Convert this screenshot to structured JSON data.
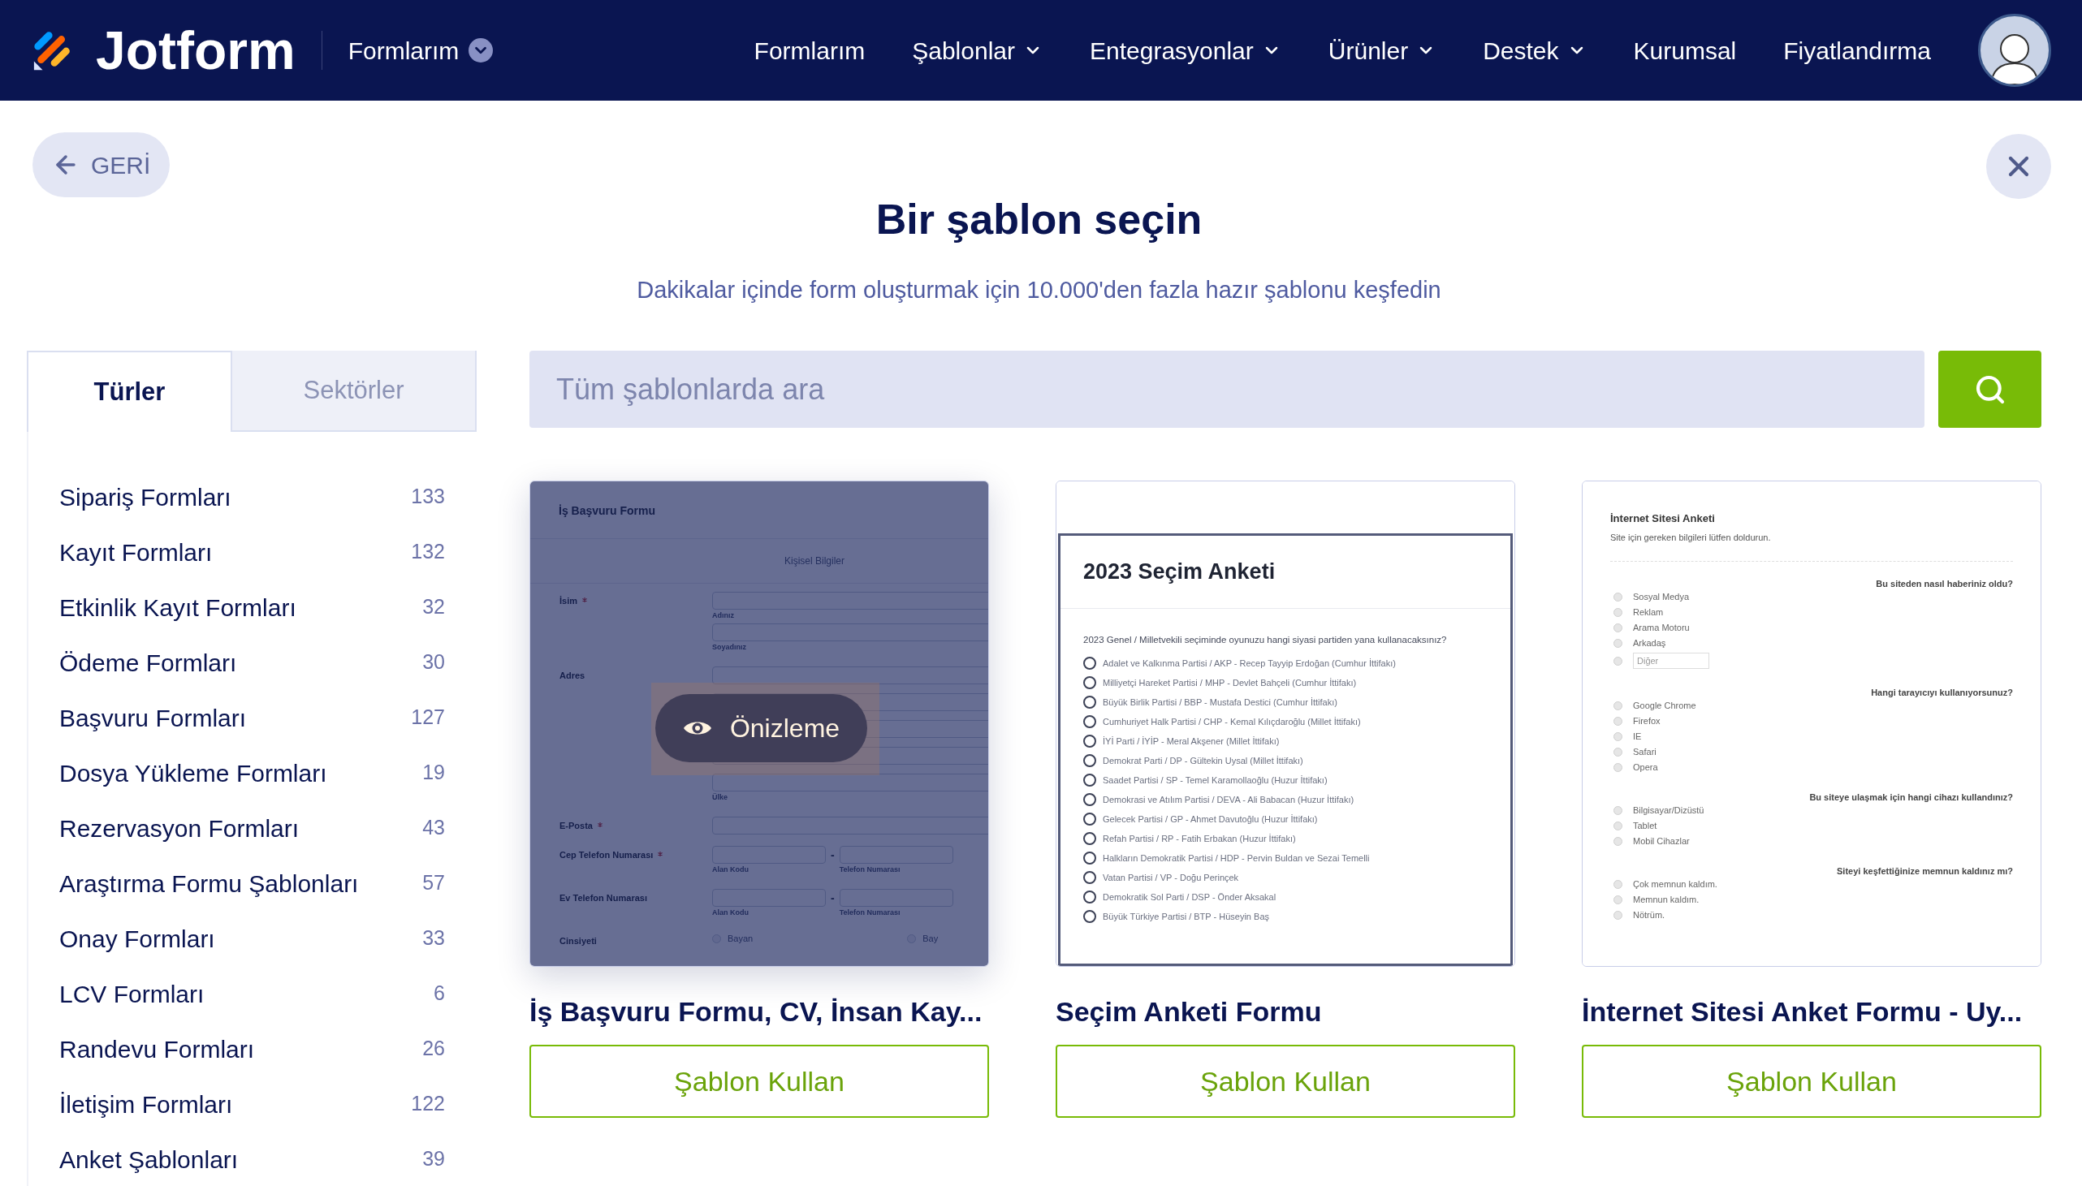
{
  "header": {
    "logo_text": "Jotform",
    "workspace_menu": "Formlarım",
    "nav": [
      {
        "label": "Formlarım",
        "has_menu": false
      },
      {
        "label": "Şablonlar",
        "has_menu": true
      },
      {
        "label": "Entegrasyonlar",
        "has_menu": true
      },
      {
        "label": "Ürünler",
        "has_menu": true
      },
      {
        "label": "Destek",
        "has_menu": true
      },
      {
        "label": "Kurumsal",
        "has_menu": false
      },
      {
        "label": "Fiyatlandırma",
        "has_menu": false
      }
    ]
  },
  "back_button": "GERİ",
  "title": "Bir şablon seçin",
  "subtitle": "Dakikalar içinde form oluşturmak için 10.000'den fazla hazır şablonu keşfedin",
  "sidebar": {
    "tabs": [
      {
        "label": "Türler",
        "selected": true
      },
      {
        "label": "Sektörler",
        "selected": false
      }
    ],
    "items": [
      {
        "label": "Sipariş Formları",
        "count": "133"
      },
      {
        "label": "Kayıt Formları",
        "count": "132"
      },
      {
        "label": "Etkinlik Kayıt Formları",
        "count": "32"
      },
      {
        "label": "Ödeme Formları",
        "count": "30"
      },
      {
        "label": "Başvuru Formları",
        "count": "127"
      },
      {
        "label": "Dosya Yükleme Formları",
        "count": "19"
      },
      {
        "label": "Rezervasyon Formları",
        "count": "43"
      },
      {
        "label": "Araştırma Formu Şablonları",
        "count": "57"
      },
      {
        "label": "Onay Formları",
        "count": "33"
      },
      {
        "label": "LCV Formları",
        "count": "6"
      },
      {
        "label": "Randevu Formları",
        "count": "26"
      },
      {
        "label": "İletişim Formları",
        "count": "122"
      },
      {
        "label": "Anket Şablonları",
        "count": "39"
      }
    ]
  },
  "search": {
    "placeholder": "Tüm şablonlarda ara"
  },
  "cards": [
    {
      "title": "İş Başvuru Formu, CV, İnsan Kay...",
      "button": "Şablon Kullan",
      "hovered": true,
      "overlay_label": "Önizleme",
      "preview": {
        "kind": "job_form",
        "title": "İş Başvuru Formu",
        "section": "Kişisel Bilgiler",
        "fields": [
          {
            "kind": "stack",
            "label": "İsim",
            "required": true,
            "sublabels": [
              "Adınız",
              "Soyadınız"
            ]
          },
          {
            "kind": "address",
            "label": "Adres",
            "required": false,
            "sublabel": "Ülke"
          },
          {
            "kind": "single",
            "label": "E-Posta",
            "required": true
          },
          {
            "kind": "phone",
            "label": "Cep Telefon Numarası",
            "required": true,
            "separator": "-",
            "sublabels": [
              "Alan Kodu",
              "Telefon Numarası"
            ]
          },
          {
            "kind": "phone",
            "label": "Ev Telefon Numarası",
            "required": false,
            "separator": "-",
            "sublabels": [
              "Alan Kodu",
              "Telefon Numarası"
            ]
          },
          {
            "kind": "radio",
            "label": "Cinsiyeti",
            "required": false,
            "options": [
              {
                "label": "Bayan",
                "selected": false
              },
              {
                "label": "Bay",
                "selected": false
              }
            ]
          }
        ]
      }
    },
    {
      "title": "Seçim Anketi Formu",
      "button": "Şablon Kullan",
      "hovered": false,
      "preview": {
        "kind": "poll",
        "title": "2023 Seçim Anketi",
        "question": "2023 Genel / Milletvekili seçiminde oyunuzu hangi siyasi partiden yana kullanacaksınız?",
        "options": [
          {
            "label": "Adalet ve Kalkınma Partisi / AKP - Recep Tayyip Erdoğan (Cumhur İttifakı)",
            "selected": false
          },
          {
            "label": "Milliyetçi Hareket Partisi / MHP - Devlet Bahçeli (Cumhur İttifakı)",
            "selected": false
          },
          {
            "label": "Büyük Birlik Partisi / BBP - Mustafa Destici (Cumhur İttifakı)",
            "selected": false
          },
          {
            "label": "Cumhuriyet Halk Partisi / CHP - Kemal Kılıçdaroğlu (Millet İttifakı)",
            "selected": false
          },
          {
            "label": "İYİ Parti / İYİP - Meral Akşener (Millet İttifakı)",
            "selected": false
          },
          {
            "label": "Demokrat Parti / DP - Gültekin Uysal (Millet İttifakı)",
            "selected": false
          },
          {
            "label": "Saadet Partisi / SP - Temel Karamollaoğlu (Huzur İttifakı)",
            "selected": false
          },
          {
            "label": "Demokrasi ve Atılım Partisi / DEVA - Ali Babacan (Huzur İttifakı)",
            "selected": false
          },
          {
            "label": "Gelecek Partisi / GP - Ahmet Davutoğlu (Huzur İttifakı)",
            "selected": false
          },
          {
            "label": "Refah Partisi / RP - Fatih Erbakan (Huzur İttifakı)",
            "selected": false
          },
          {
            "label": "Halkların Demokratik Partisi / HDP - Pervin Buldan ve Sezai Temelli",
            "selected": false
          },
          {
            "label": "Vatan Partisi / VP - Doğu Perinçek",
            "selected": false
          },
          {
            "label": "Demokratik Sol Parti / DSP - Önder Aksakal",
            "selected": false
          },
          {
            "label": "Büyük Türkiye Partisi / BTP - Hüseyin Baş",
            "selected": false
          }
        ]
      }
    },
    {
      "title": "İnternet Sitesi Anket Formu - Uy...",
      "button": "Şablon Kullan",
      "hovered": false,
      "preview": {
        "kind": "survey",
        "title": "İnternet Sitesi Anketi",
        "subtitle": "Site için gereken bilgileri lütfen doldurun.",
        "questions": [
          {
            "label": "Bu siteden nasıl haberiniz oldu?",
            "options": [
              {
                "label": "Sosyal Medya",
                "selected": false
              },
              {
                "label": "Reklam",
                "selected": false
              },
              {
                "label": "Arama Motoru",
                "selected": false
              },
              {
                "label": "Arkadaş",
                "selected": false
              }
            ],
            "other": {
              "placeholder": "Diğer",
              "selected": false
            }
          },
          {
            "label": "Hangi tarayıcıyı kullanıyorsunuz?",
            "options": [
              {
                "label": "Google Chrome",
                "selected": false
              },
              {
                "label": "Firefox",
                "selected": false
              },
              {
                "label": "IE",
                "selected": false
              },
              {
                "label": "Safari",
                "selected": false
              },
              {
                "label": "Opera",
                "selected": false
              }
            ]
          },
          {
            "label": "Bu siteye ulaşmak için hangi cihazı kullandınız?",
            "options": [
              {
                "label": "Bilgisayar/Dizüstü",
                "selected": false
              },
              {
                "label": "Tablet",
                "selected": false
              },
              {
                "label": "Mobil Cihazlar",
                "selected": false
              }
            ]
          },
          {
            "label": "Siteyi keşfettiğinize memnun kaldınız mı?",
            "options": [
              {
                "label": "Çok memnun kaldım.",
                "selected": false
              },
              {
                "label": "Memnun kaldım.",
                "selected": false
              },
              {
                "label": "Nötrüm.",
                "selected": false
              }
            ]
          }
        ]
      }
    }
  ]
}
